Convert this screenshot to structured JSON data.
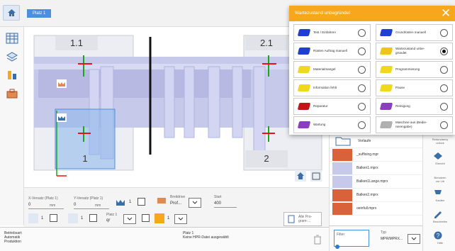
{
  "breadcrumb": "Platz 1",
  "machine": {
    "label_tl": "1.1",
    "label_tr": "2.1",
    "label_bl": "1",
    "label_br": "2"
  },
  "controls": {
    "x_versatz": {
      "label": "X-Versatz (Platz 1)",
      "value": "0",
      "unit": "mm"
    },
    "y_versatz": {
      "label": "Y-Versatz (Platz 1)",
      "value": "0",
      "unit": "mm"
    },
    "count1": "1",
    "reihen": {
      "label": "Breitdrive",
      "value": "Prof..."
    },
    "wert": {
      "label": "Start",
      "value": "400"
    },
    "count2": "1",
    "count3": "1",
    "platz": {
      "label": "Platz 1",
      "value": "qr"
    },
    "count4": "1",
    "alle_programme": "Alle Pro-\ngram-..."
  },
  "status": {
    "left": "Betriebsart:\nAutomatik\nProduktion",
    "center": "Platz 1\nKeine HPR-Datei ausgewählt"
  },
  "filelist": {
    "folder": "Vorlaufe",
    "files": [
      "_suffixing.mpr",
      "Balken1.mprx",
      "Balken1Lange.mprx",
      "Balken2.mprx",
      "oeinfull.mprx"
    ]
  },
  "filter": {
    "placeholder": "Filter",
    "type_label": "Typ",
    "type_value": "MPR/MPRX..."
  },
  "rightside": {
    "items": [
      "Redundancy\nunlock",
      "Einricht",
      "Benutzen\nzur Lib",
      "Kaufen",
      "Beschreibe",
      "Hilfe"
    ]
  },
  "popup": {
    "title": "Wartezustand unbegründet",
    "items": [
      {
        "label": "Test / Einfahren",
        "color": "#1f3fd1",
        "selected": false
      },
      {
        "label": "Grundrüsten manuell",
        "color": "#1f3fd1",
        "selected": false
      },
      {
        "label": "Rüsten Auftrag manuell",
        "color": "#1f3fd1",
        "selected": false
      },
      {
        "label": "Wartezustand unbe-\ngründet",
        "color": "#f0c419",
        "selected": true
      },
      {
        "label": "Materialmangel",
        "color": "#f0d81a",
        "selected": false
      },
      {
        "label": "Programmierung",
        "color": "#f0d81a",
        "selected": false
      },
      {
        "label": "Information fehlt",
        "color": "#f0d81a",
        "selected": false
      },
      {
        "label": "Pause",
        "color": "#f0d81a",
        "selected": false
      },
      {
        "label": "Reparatur",
        "color": "#c0161a",
        "selected": false
      },
      {
        "label": "Reinigung",
        "color": "#8a3fc0",
        "selected": false
      },
      {
        "label": "Wartung",
        "color": "#8a3fc0",
        "selected": false
      },
      {
        "label": "Maschine aus (Bedie-\nnerengabe)",
        "color": "#b0b0b0",
        "selected": false
      }
    ]
  }
}
